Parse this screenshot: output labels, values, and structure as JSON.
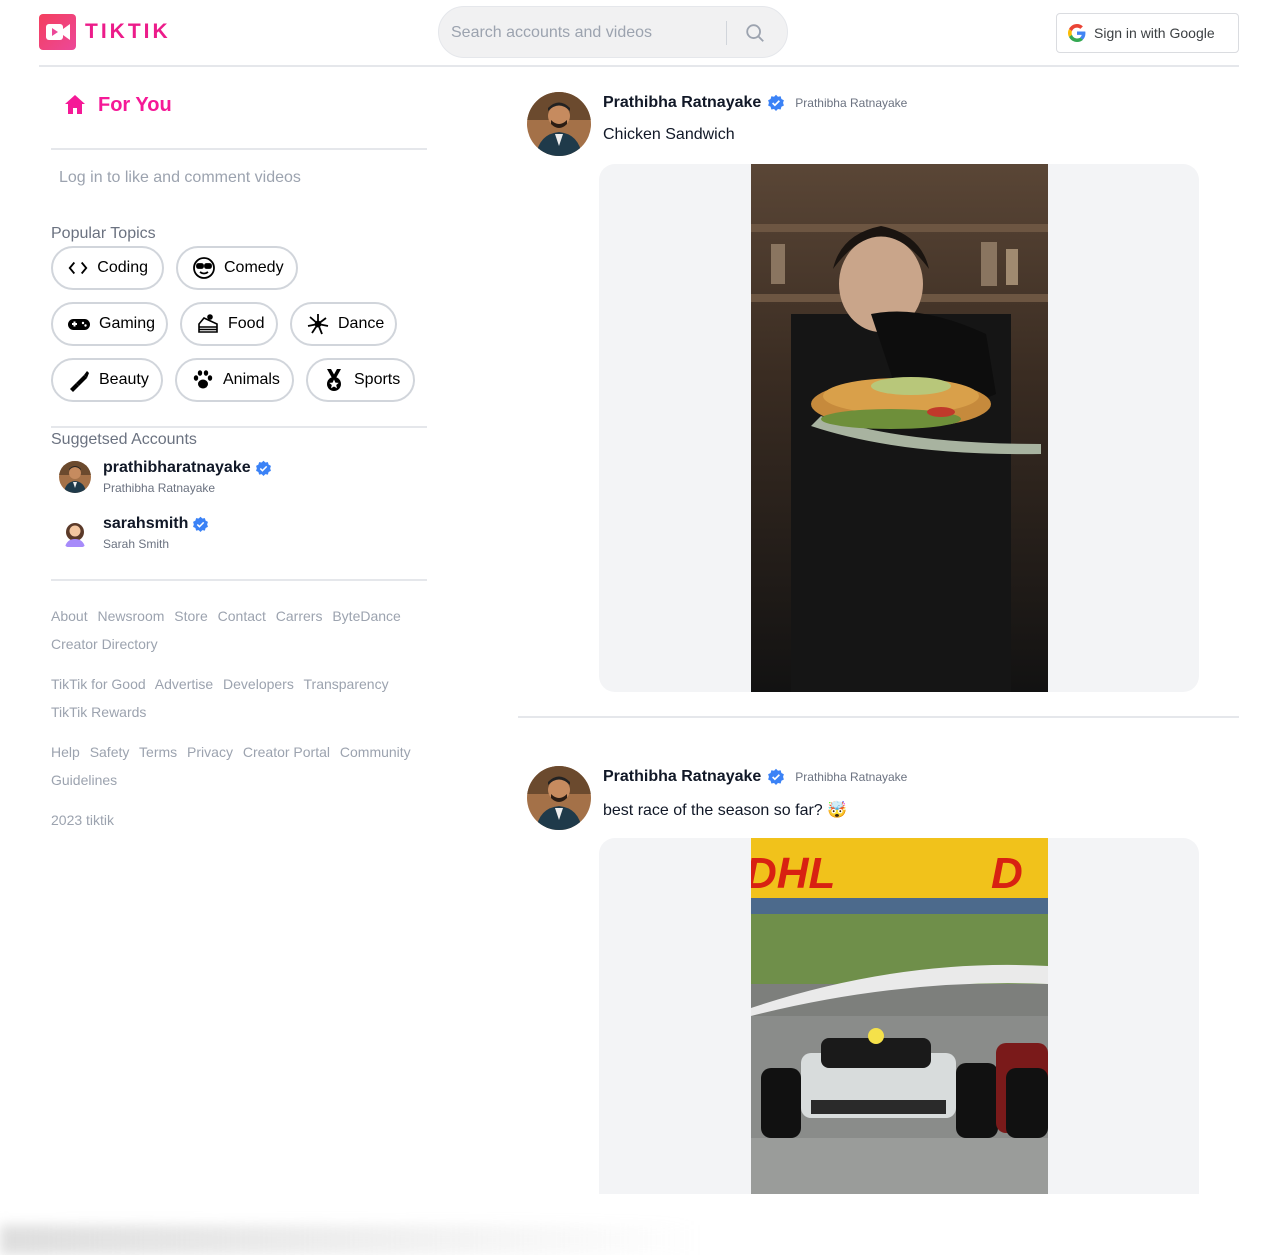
{
  "brand": {
    "name": "TIKTIK"
  },
  "search": {
    "placeholder": "Search accounts and videos"
  },
  "auth": {
    "signin_label": "Sign in with Google"
  },
  "sidebar": {
    "for_you": "For You",
    "login_note": "Log in to like and comment videos",
    "topics_title": "Popular Topics",
    "topics": [
      {
        "label": "Coding",
        "icon": "code-icon"
      },
      {
        "label": "Comedy",
        "icon": "sunglasses-face-icon"
      },
      {
        "label": "Gaming",
        "icon": "gamepad-icon"
      },
      {
        "label": "Food",
        "icon": "cake-icon"
      },
      {
        "label": "Dance",
        "icon": "spiral-icon"
      },
      {
        "label": "Beauty",
        "icon": "lipstick-icon"
      },
      {
        "label": "Animals",
        "icon": "paw-icon"
      },
      {
        "label": "Sports",
        "icon": "medal-icon"
      }
    ],
    "accounts_title": "Suggetsed Accounts",
    "accounts": [
      {
        "username": "prathibharatnayake",
        "name": "Prathibha Ratnayake"
      },
      {
        "username": "sarahsmith",
        "name": "Sarah Smith"
      }
    ],
    "footer": {
      "row1": [
        "About",
        "Newsroom",
        "Store",
        "Contact",
        "Carrers",
        "ByteDance",
        "Creator Directory"
      ],
      "row2": [
        "TikTik for Good",
        "Advertise",
        "Developers",
        "Transparency",
        "TikTik Rewards"
      ],
      "row3": [
        "Help",
        "Safety",
        "Terms",
        "Privacy",
        "Creator Portal",
        "Community Guidelines"
      ],
      "copyright": "2023 tiktik"
    }
  },
  "feed": [
    {
      "user": "Prathibha Ratnayake",
      "subname": "Prathibha Ratnayake",
      "caption": "Chicken Sandwich"
    },
    {
      "user": "Prathibha Ratnayake",
      "subname": "Prathibha Ratnayake",
      "caption": "best race of the season so far? 🤯"
    }
  ],
  "colors": {
    "brand_pink": "#f51997",
    "verified_blue": "#3b82f6"
  }
}
